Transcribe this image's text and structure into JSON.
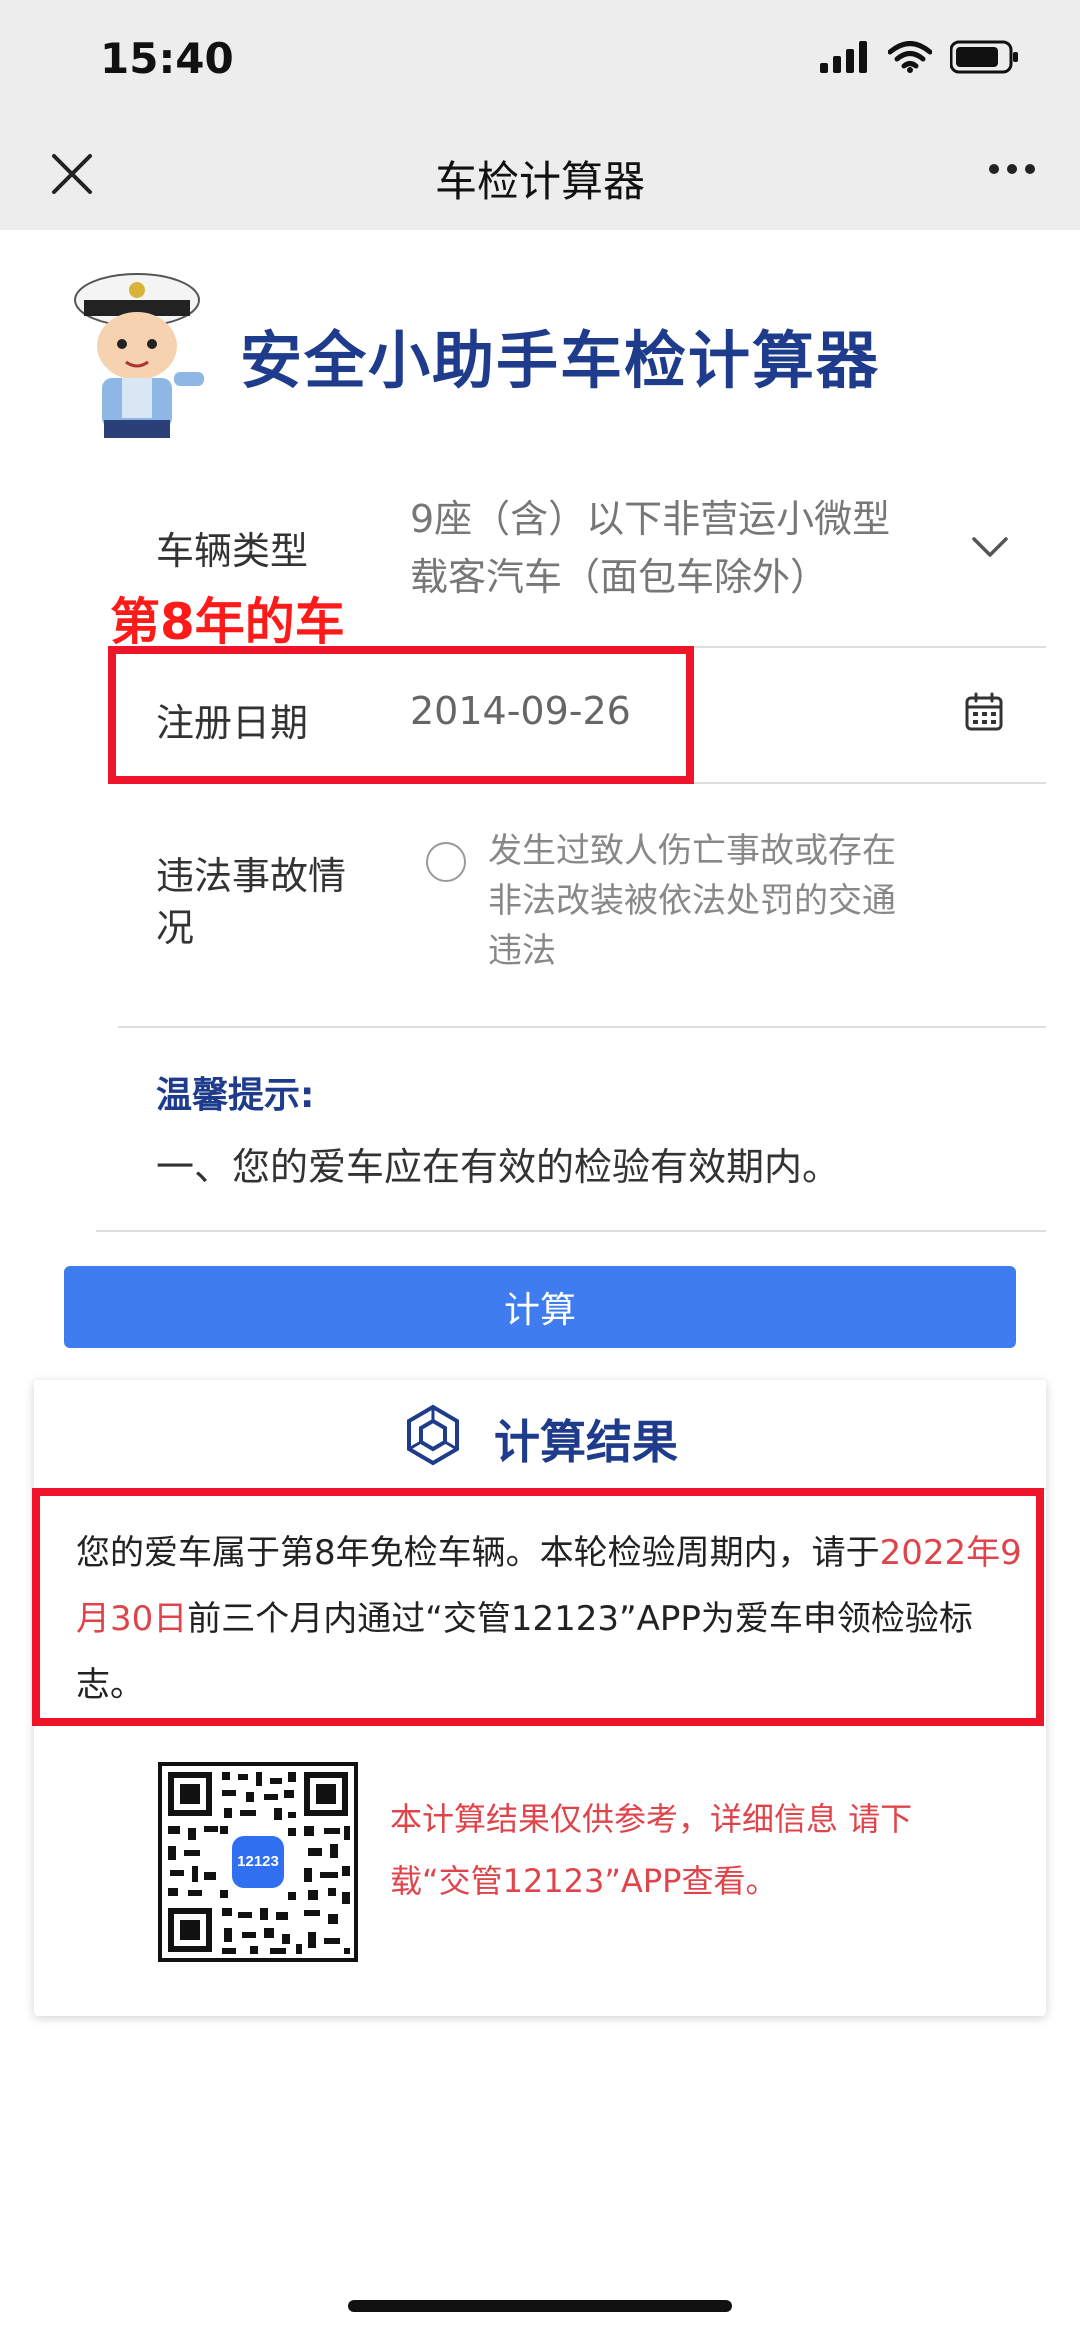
{
  "status_bar": {
    "time": "15:40"
  },
  "nav": {
    "title": "车检计算器"
  },
  "header": {
    "app_title": "安全小助手车检计算器"
  },
  "form": {
    "vehicle_type_label": "车辆类型",
    "vehicle_type_value_line1": "9座（含）以下非营运小微型",
    "vehicle_type_value_line2": "载客汽车（面包车除外）",
    "reg_date_label": "注册日期",
    "reg_date_value": "2014-09-26",
    "violation_label_line1": "违法事故情",
    "violation_label_line2": "况",
    "violation_option_line1": "发生过致人伤亡事故或存在",
    "violation_option_line2": "非法改装被依法处罚的交通",
    "violation_option_line3": "违法"
  },
  "annotation": {
    "label": "第8年的车"
  },
  "tip": {
    "title": "温馨提示:",
    "text": "一、您的爱车应在有效的检验有效期内。"
  },
  "calc_button": {
    "label": "计算"
  },
  "result": {
    "title": "计算结果",
    "text_before": "您的爱车属于第8年免检车辆。本轮检验周期内，请于",
    "text_highlight": "2022年9月30日",
    "text_after": "前三个月内通过“交管12123”APP为爱车申领检验标志。",
    "qr_badge": "12123",
    "note": "本计算结果仅供参考，详细信息 请下载“交管12123”APP查看。"
  },
  "colors": {
    "brand_blue": "#1e3b8c",
    "button_blue": "#3e7cf0",
    "highlight_red": "#e0444b",
    "annotation_red": "#f0142b"
  }
}
